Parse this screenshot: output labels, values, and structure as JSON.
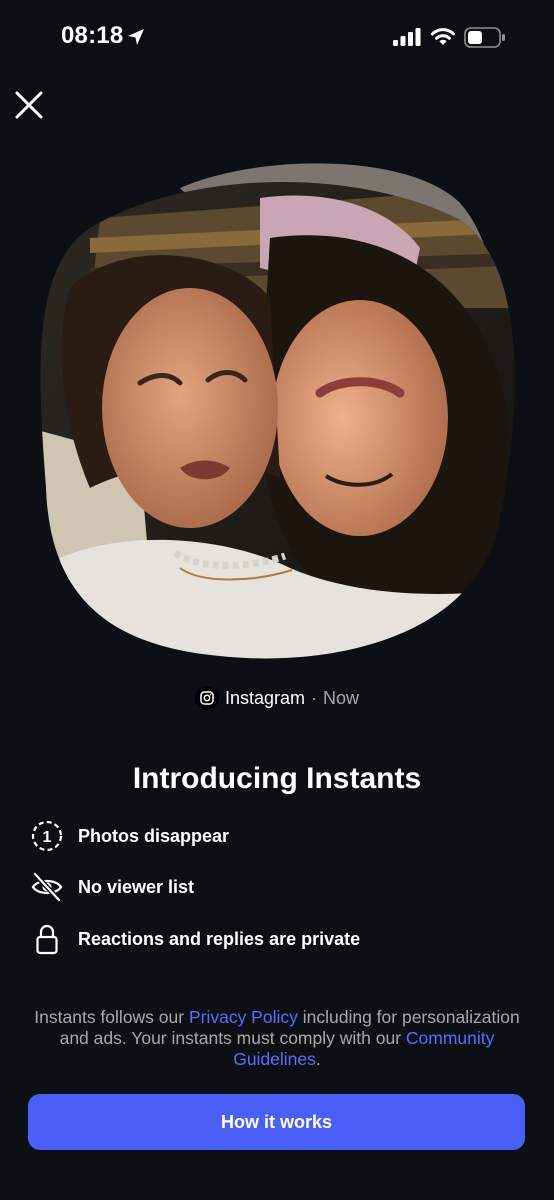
{
  "status_bar": {
    "time": "08:18",
    "icons": [
      "location-arrow-icon",
      "cellular-signal-icon",
      "wifi-icon",
      "battery-icon"
    ]
  },
  "header": {
    "close_icon": "close-icon"
  },
  "post": {
    "source_app": "Instagram",
    "separator": "·",
    "time": "Now"
  },
  "intro": {
    "title": "Introducing Instants",
    "features": [
      {
        "icon": "timer-one-icon",
        "label": "Photos disappear"
      },
      {
        "icon": "eye-off-icon",
        "label": "No viewer list"
      },
      {
        "icon": "lock-icon",
        "label": "Reactions and replies are private"
      }
    ]
  },
  "legal": {
    "text_1": "Instants follows our ",
    "privacy_link": "Privacy Policy",
    "text_2": " including for personalization and ads. Your instants must comply with our ",
    "guidelines_link": "Community Guidelines",
    "text_3": "."
  },
  "cta": {
    "label": "How it works"
  },
  "colors": {
    "background": "#0c1014",
    "accent": "#4a5ff7",
    "link": "#5b6cff",
    "muted": "#a8a8a8"
  }
}
